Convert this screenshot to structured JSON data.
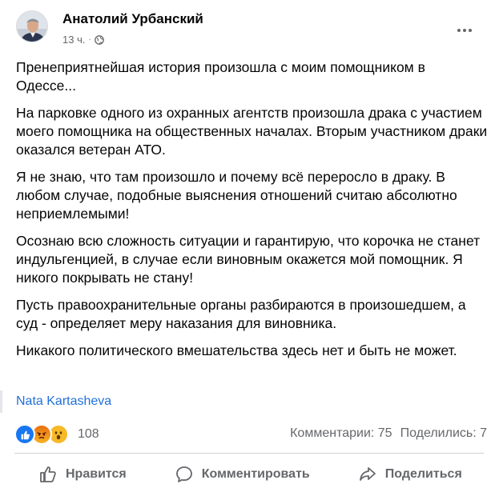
{
  "post": {
    "author": "Анатолий Урбанский",
    "time": "13 ч.",
    "separator": "·",
    "paragraphs": [
      "Пренеприятнейшая история произошла с моим помощником в Одессе...",
      "На парковке одного из охранных агентств произошла драка с участием моего помощника на общественных началах. Вторым участником драки оказался ветеран АТО.",
      "Я не знаю, что там произошло и почему всё переросло в драку. В любом случае, подобные выяснения отношений считаю абсолютно неприемлемыми!",
      "Осознаю всю сложность ситуации и гарантирую, что корочка не станет индульгенцией, в случае если виновным окажется мой помощник. Я никого покрывать не стану!",
      "Пусть правоохранительные органы разбираются в произошедшем, а суд - определяет меру наказания для виновника.",
      "Никакого политического вмешательства здесь нет и быть не может."
    ],
    "byline": "Nata Kartasheva"
  },
  "stats": {
    "reaction_count": "108",
    "comments": "Комментарии: 75",
    "shares": "Поделились: 7",
    "reaction_icons": [
      "like-icon",
      "angry-icon",
      "wow-icon"
    ]
  },
  "actions": {
    "like": "Нравится",
    "comment": "Комментировать",
    "share": "Поделиться"
  },
  "colors": {
    "link": "#216fdb",
    "muted": "#65676b",
    "like": "#1877f2"
  }
}
